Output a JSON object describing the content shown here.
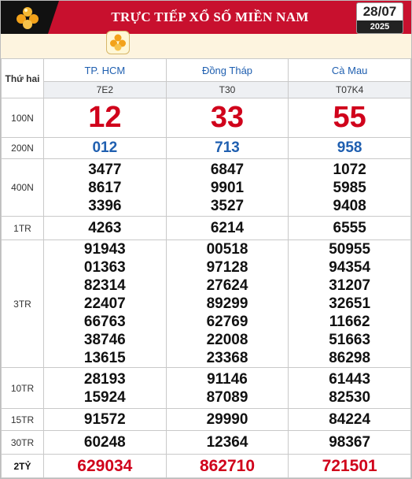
{
  "header": {
    "title": "TRỰC TIẾP XỔ SỐ MIỀN NAM",
    "date_day": "28/07",
    "date_year": "2025"
  },
  "table": {
    "day_label": "Thứ hai",
    "provinces": [
      {
        "name": "TP. HCM",
        "code": "7E2"
      },
      {
        "name": "Đồng Tháp",
        "code": "T30"
      },
      {
        "name": "Cà Mau",
        "code": "T07K4"
      }
    ],
    "prizes": [
      {
        "label": "100N",
        "values": [
          [
            "12"
          ],
          [
            "33"
          ],
          [
            "55"
          ]
        ]
      },
      {
        "label": "200N",
        "values": [
          [
            "012"
          ],
          [
            "713"
          ],
          [
            "958"
          ]
        ]
      },
      {
        "label": "400N",
        "values": [
          [
            "3477",
            "8617",
            "3396"
          ],
          [
            "6847",
            "9901",
            "3527"
          ],
          [
            "1072",
            "5985",
            "9408"
          ]
        ]
      },
      {
        "label": "1TR",
        "values": [
          [
            "4263"
          ],
          [
            "6214"
          ],
          [
            "6555"
          ]
        ]
      },
      {
        "label": "3TR",
        "values": [
          [
            "91943",
            "01363",
            "82314",
            "22407",
            "66763",
            "38746",
            "13615"
          ],
          [
            "00518",
            "97128",
            "27624",
            "89299",
            "62769",
            "22008",
            "23368"
          ],
          [
            "50955",
            "94354",
            "31207",
            "32651",
            "11662",
            "51663",
            "86298"
          ]
        ]
      },
      {
        "label": "10TR",
        "values": [
          [
            "28193",
            "15924"
          ],
          [
            "91146",
            "87089"
          ],
          [
            "61443",
            "82530"
          ]
        ]
      },
      {
        "label": "15TR",
        "values": [
          [
            "91572"
          ],
          [
            "29990"
          ],
          [
            "84224"
          ]
        ]
      },
      {
        "label": "30TR",
        "values": [
          [
            "60248"
          ],
          [
            "12364"
          ],
          [
            "98367"
          ]
        ]
      },
      {
        "label": "2TỶ",
        "values": [
          [
            "629034"
          ],
          [
            "862710"
          ],
          [
            "721501"
          ]
        ]
      }
    ]
  },
  "icons": {
    "logo": "lottery-balls-icon",
    "band": "lottery-balls-icon"
  },
  "colors": {
    "header_bg": "#c8102e",
    "prize_red": "#d0021b",
    "prize_blue": "#1f5fb0"
  }
}
